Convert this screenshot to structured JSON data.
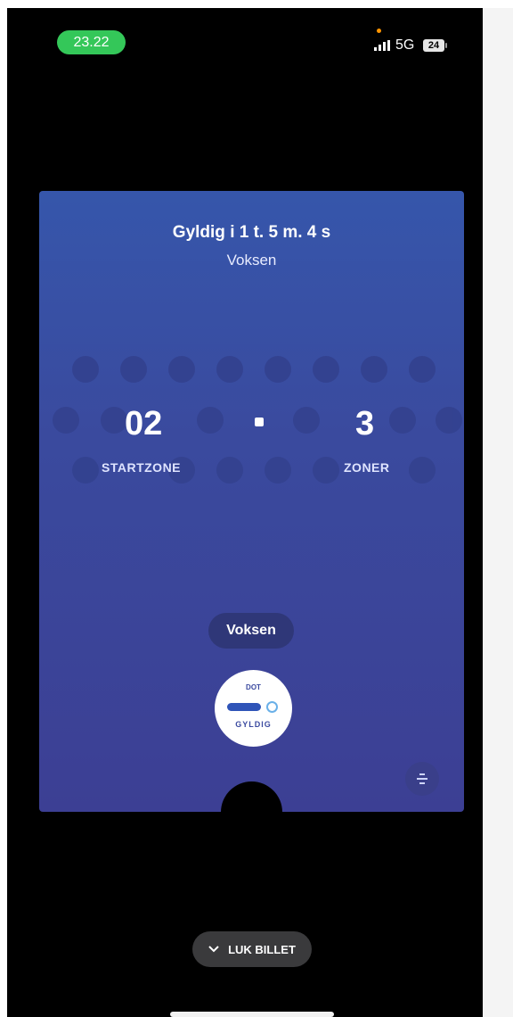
{
  "status_bar": {
    "time": "23.22",
    "network": "5G",
    "battery": "24"
  },
  "ticket": {
    "validity": "Gyldig i 1 t. 5 m. 4 s",
    "passenger_type": "Voksen",
    "start_zone": {
      "value": "02",
      "label": "STARTZONE"
    },
    "zones": {
      "value": "3",
      "label": "ZONER"
    },
    "type_pill": "Voksen",
    "badge": {
      "top": "DOT",
      "bottom": "GYLDIG"
    },
    "colors": {
      "card_top": "#3656ab",
      "card_bottom": "#3c3f94",
      "accent_green": "#34c759"
    }
  },
  "close_button": {
    "label": "LUK BILLET",
    "icon": "chevron-down-icon"
  }
}
